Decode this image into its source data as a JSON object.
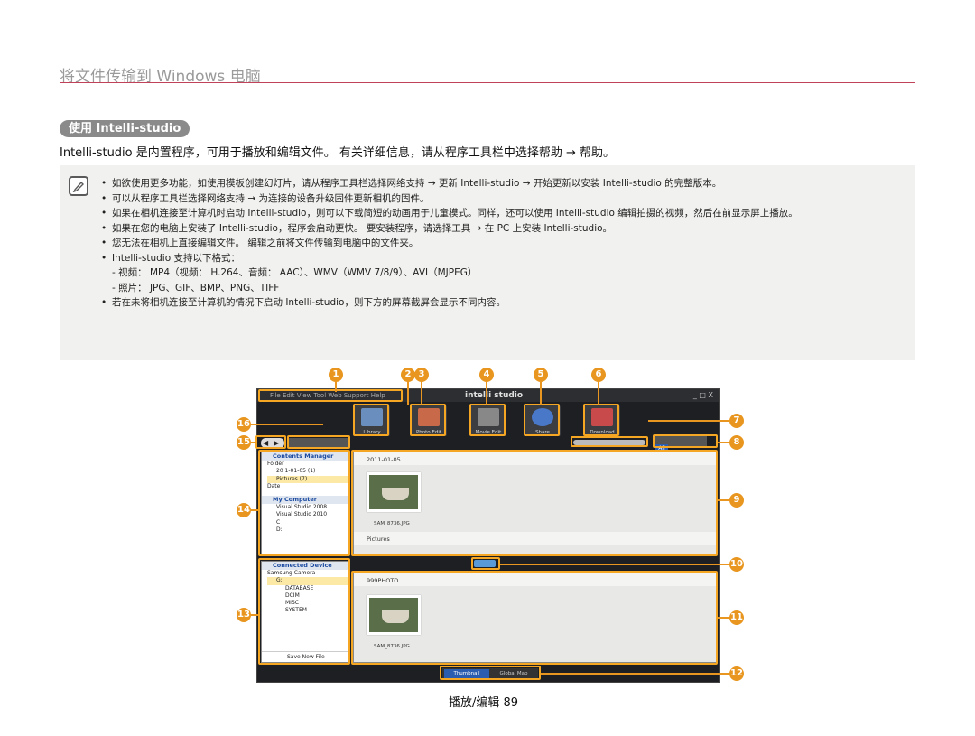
{
  "header": {
    "title": "将文件传输到 Windows 电脑"
  },
  "section": {
    "pill": "使用 Intelli-studio",
    "intro": "Intelli-studio 是内置程序，可用于播放和编辑文件。 有关详细信息，请从程序工具栏中选择帮助 → 帮助。"
  },
  "note": {
    "items": [
      "如欲使用更多功能，如使用模板创建幻灯片，请从程序工具栏选择网络支持 → 更新 Intelli-studio → 开始更新以安装 Intelli-studio 的完整版本。",
      "可以从程序工具栏选择网络支持 → 为连接的设备升级固件更新相机的固件。",
      "如果在相机连接至计算机时启动 Intelli-studio，则可以下载简短的动画用于儿童模式。同样，还可以使用 Intelli-studio 编辑拍摄的视频，然后在前显示屏上播放。",
      "如果在您的电脑上安装了 Intelli-studio，程序会启动更快。 要安装程序，请选择工具 → 在 PC 上安装 Intelli-studio。",
      "您无法在相机上直接编辑文件。 编辑之前将文件传输到电脑中的文件夹。",
      "Intelli-studio 支持以下格式："
    ],
    "sub": [
      "- 视频： MP4（视频： H.264、音频： AAC）、WMV（WMV 7/8/9）、AVI（MJPEG）",
      "- 照片： JPG、GIF、BMP、PNG、TIFF"
    ],
    "last": "若在未将相机连接至计算机的情况下启动 Intelli-studio，则下方的屏幕截屏会显示不同内容。"
  },
  "app": {
    "menu": "File  Edit  View  Tool  Web Support  Help",
    "logo": "intelli studio",
    "win_controls": "_ □ X",
    "tools": [
      "Library",
      "Photo Edit",
      "Movie Edit",
      "Share",
      "Download"
    ],
    "view_all": "All",
    "contents_manager": "Contents Manager",
    "tree1": [
      "Folder",
      "20 1-01-05    (1)",
      "Pictures     (7)",
      "Date"
    ],
    "my_computer": "My Computer",
    "tree2": [
      "Visual Studio 2008",
      "Visual Studio 2010",
      "C",
      "D:"
    ],
    "connected_device": "Connected Device",
    "tree3": [
      "Samsung Camera",
      "G:",
      "DATABASE",
      "DCIM",
      "MISC",
      "SYSTEM"
    ],
    "save_new_file": "Save New File",
    "date_folder": "2011-01-05",
    "file1": "SAM_8736.JPG",
    "pictures": "Pictures",
    "device_folder": "999PHOTO",
    "file2": "SAM_8736.JPG",
    "tab_thumbnail": "Thumbnail",
    "tab_globalmap": "Global Map"
  },
  "callouts": [
    "1",
    "2",
    "3",
    "4",
    "5",
    "6",
    "7",
    "8",
    "9",
    "10",
    "11",
    "12",
    "13",
    "14",
    "15",
    "16"
  ],
  "footer": {
    "page": "播放/编辑  89"
  }
}
